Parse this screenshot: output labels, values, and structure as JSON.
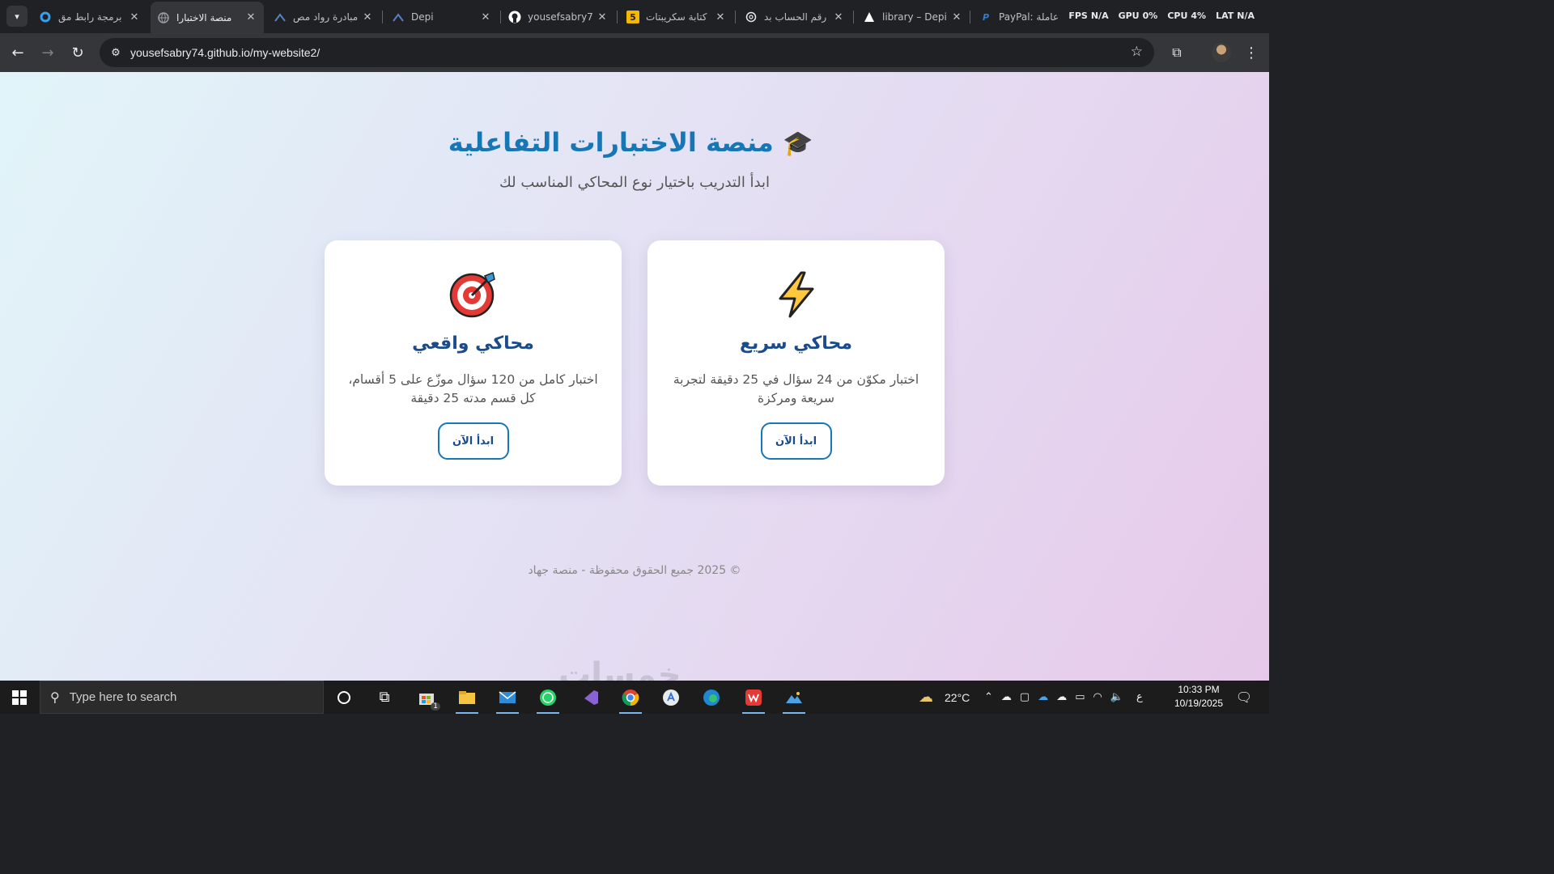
{
  "browser": {
    "tabs": [
      {
        "label": "برمجة رابط مق",
        "icon": "blue-ring-icon",
        "active": false
      },
      {
        "label": "منصة الاختبارا",
        "icon": "globe-icon",
        "active": true
      },
      {
        "label": "مبادرة رواد مص",
        "icon": "depi-icon",
        "active": false
      },
      {
        "label": "Depi",
        "icon": "depi-icon",
        "active": false
      },
      {
        "label": "yousefsabry7",
        "icon": "github-icon",
        "active": false
      },
      {
        "label": "كتابة سكريبتات",
        "icon": "number5-icon",
        "active": false
      },
      {
        "label": "رقم الحساب بد",
        "icon": "chatgpt-icon",
        "active": false
      },
      {
        "label": "library – Depi",
        "icon": "triangle-icon",
        "active": false
      },
      {
        "label": "PayPal: عاملة",
        "icon": "paypal-icon",
        "active": false
      }
    ],
    "perf": {
      "fps_label": "FPS",
      "fps_value": "N/A",
      "gpu_label": "GPU",
      "gpu_value": "0%",
      "cpu_label": "CPU",
      "cpu_value": "4%",
      "lat_label": "LAT",
      "lat_value": "N/A"
    },
    "url": "yousefsabry74.github.io/my-website2/"
  },
  "page": {
    "title": "منصة الاختبارات التفاعلية",
    "title_icon": "🎓",
    "subtitle": "ابدأ التدريب باختيار نوع المحاكي المناسب لك",
    "cards": [
      {
        "title": "محاكي واقعي",
        "icon": "target-icon",
        "description": "اختبار كامل من 120 سؤال موزّع على 5 أقسام، كل قسم مدته 25 دقيقة",
        "button": "ابدأ الآن"
      },
      {
        "title": "محاكي سريع",
        "icon": "lightning-icon",
        "description": "اختبار مكوّن من 24 سؤال في 25 دقيقة لتجربة سريعة ومركزة",
        "button": "ابدأ الآن"
      }
    ],
    "footer": "© 2025 جميع الحقوق محفوظة - منصة جهاد"
  },
  "taskbar": {
    "search_placeholder": "Type here to search",
    "weather": "22°C",
    "lang": "ع",
    "time": "10:33 PM",
    "date": "10/19/2025",
    "store_badge": "1"
  }
}
